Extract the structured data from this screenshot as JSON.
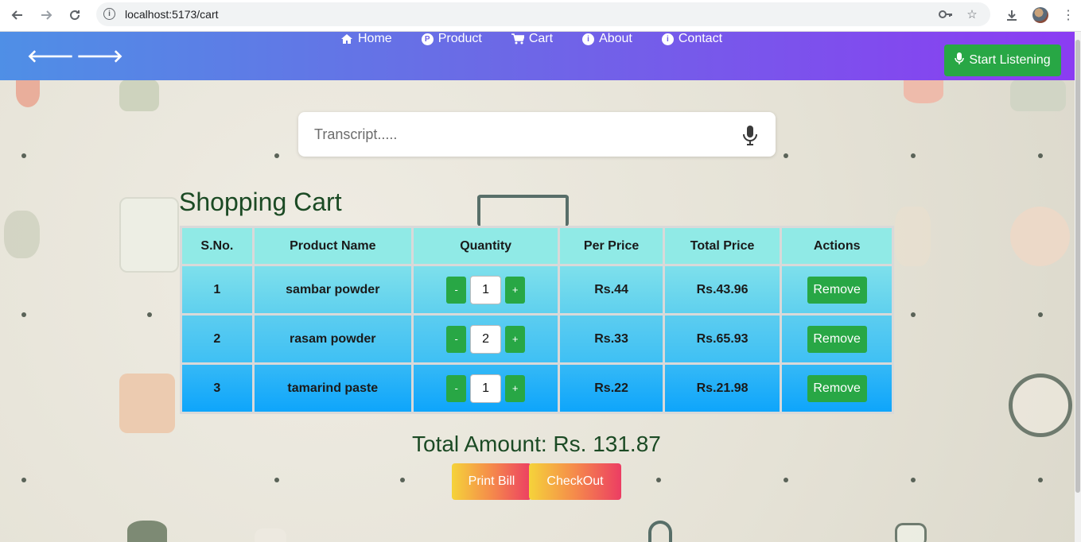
{
  "browser": {
    "url": "localhost:5173/cart",
    "back_icon": "arrow-left-icon",
    "forward_icon": "arrow-right-icon",
    "reload_icon": "reload-icon"
  },
  "navbar": {
    "links": [
      {
        "label": "Home",
        "icon": "home-icon"
      },
      {
        "label": "Product",
        "icon": "product-icon"
      },
      {
        "label": "Cart",
        "icon": "cart-icon"
      },
      {
        "label": "About",
        "icon": "info-icon"
      },
      {
        "label": "Contact",
        "icon": "info-icon"
      }
    ],
    "listen_label": "Start Listening",
    "colors": {
      "gradient_start": "#4f8fe6",
      "gradient_end": "#8b3cf2",
      "button": "#28a745"
    }
  },
  "transcript": {
    "placeholder": "Transcript....."
  },
  "cart": {
    "title": "Shopping Cart",
    "headers": [
      "S.No.",
      "Product Name",
      "Quantity",
      "Per Price",
      "Total Price",
      "Actions"
    ],
    "rows": [
      {
        "sno": "1",
        "name": "sambar powder",
        "qty": "1",
        "per_price": "Rs.44",
        "total": "Rs.43.96",
        "action": "Remove"
      },
      {
        "sno": "2",
        "name": "rasam powder",
        "qty": "2",
        "per_price": "Rs.33",
        "total": "Rs.65.93",
        "action": "Remove"
      },
      {
        "sno": "3",
        "name": "tamarind paste",
        "qty": "1",
        "per_price": "Rs.22",
        "total": "Rs.21.98",
        "action": "Remove"
      }
    ],
    "decrement_label": "-",
    "increment_label": "+",
    "total_label": "Total Amount: Rs. 131.87",
    "print_label": "Print Bill",
    "checkout_label": "CheckOut"
  }
}
